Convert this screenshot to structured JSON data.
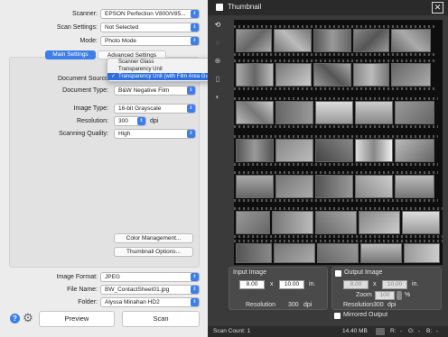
{
  "scanner": {
    "label": "Scanner:",
    "value": "EPSON Perfection V800/V85..."
  },
  "scan_settings": {
    "label": "Scan Settings:",
    "value": "Not Selected"
  },
  "mode": {
    "label": "Mode:",
    "value": "Photo Mode"
  },
  "tabs": {
    "main": "Main Settings",
    "advanced": "Advanced Settings"
  },
  "document_source": {
    "label": "Document Source",
    "options": [
      "Scanner Glass",
      "Transparency Unit",
      "Transparency Unit (with Film Area Guide)"
    ],
    "selected_check": "✓"
  },
  "document_type": {
    "label": "Document Type:",
    "value": "B&W Negative Film"
  },
  "image_type": {
    "label": "Image Type:",
    "value": "16-bit Grayscale"
  },
  "resolution": {
    "label": "Resolution:",
    "value": "300",
    "unit": "dpi"
  },
  "scanning_quality": {
    "label": "Scanning Quality:",
    "value": "High"
  },
  "buttons": {
    "color_management": "Color Management...",
    "thumbnail_options": "Thumbnail Options...",
    "preview": "Preview",
    "scan": "Scan"
  },
  "image_format": {
    "label": "Image Format:",
    "value": "JPEG"
  },
  "file_name": {
    "label": "File Name:",
    "value": "BW_ContactSheet01.jpg"
  },
  "folder": {
    "label": "Folder:",
    "value": "Alyssa Minahan HD2"
  },
  "thumbnail": {
    "title": "Thumbnail",
    "close": "✕"
  },
  "input_image": {
    "title": "Input Image",
    "width": "8.00",
    "x": "x",
    "height": "10.00",
    "unit": "in.",
    "resolution_label": "Resolution",
    "resolution_value": "300",
    "resolution_unit": "dpi"
  },
  "output_image": {
    "title": "Output Image",
    "width": "8.00",
    "x": "x",
    "height": "10.00",
    "unit": "in.",
    "zoom_label": "Zoom",
    "zoom_value": "100",
    "zoom_unit": "%",
    "resolution_label": "Resolution",
    "resolution_value": "300",
    "resolution_unit": "dpi"
  },
  "mirrored_output": "Mirrored Output",
  "status": {
    "scan_count": "Scan Count: 1",
    "size": "14.40 MB",
    "r": "R:",
    "r_val": "-",
    "g": "G:",
    "g_val": "-",
    "b": "B:",
    "b_val": "-"
  },
  "colors": {
    "accent": "#3d7ee8",
    "dark_bg": "#3a3a3a"
  }
}
